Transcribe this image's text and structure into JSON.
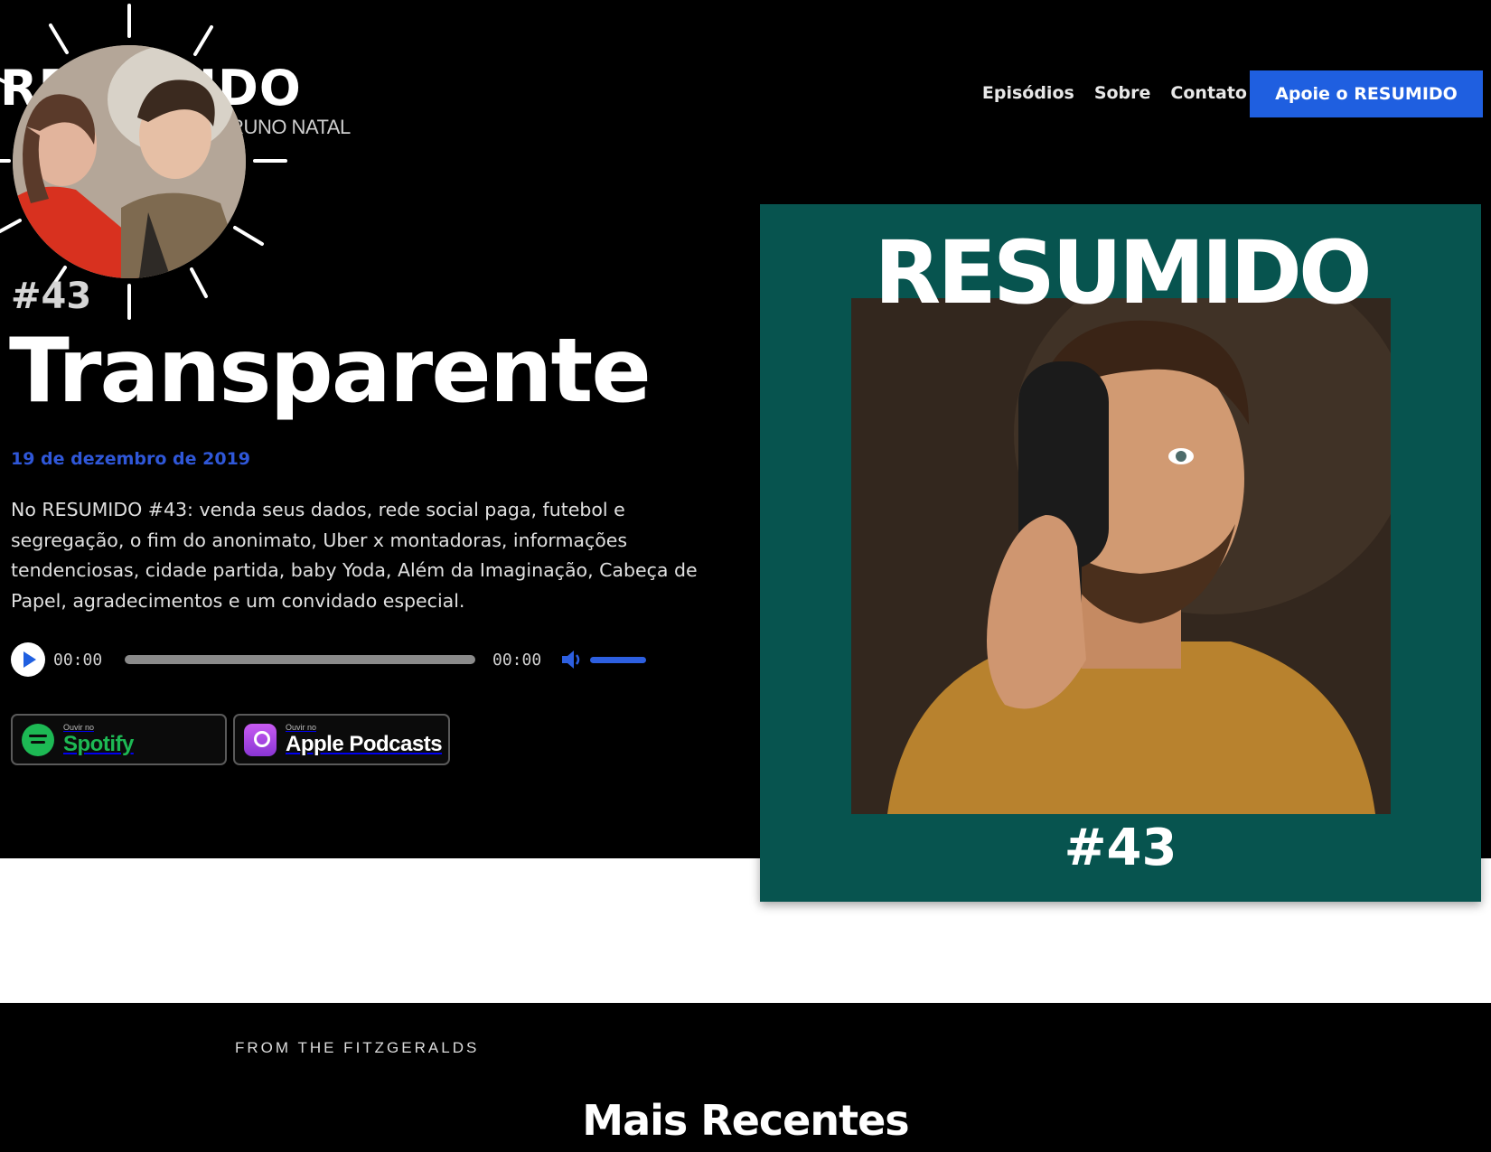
{
  "header": {
    "logo_wordmark": "RESUMIDO",
    "logo_subtitle": "BRUNO NATAL",
    "nav": [
      {
        "label": "Episódios"
      },
      {
        "label": "Sobre"
      },
      {
        "label": "Contato"
      }
    ],
    "cta_label": "Apoie o RESUMIDO"
  },
  "episode": {
    "number": "#43",
    "title": "Transparente",
    "date": "19 de dezembro de 2019",
    "description": "No RESUMIDO #43: venda seus dados, rede social paga, futebol e segregação, o fim do anonimato, Uber x montadoras, informações tendenciosas, cidade partida, baby Yoda, Além da Imaginação, Cabeça de Papel, agradecimentos e um convidado especial."
  },
  "player": {
    "current_time": "00:00",
    "total_time": "00:00",
    "progress": 0
  },
  "badges": {
    "spotify_small": "Ouvir no",
    "spotify_big": "Spotify",
    "apple_small": "Ouvir no",
    "apple_big": "Apple Podcasts"
  },
  "cover": {
    "title": "RESUMIDO",
    "number": "#43"
  },
  "footer": {
    "from_label": "FROM THE FITZGERALDS",
    "section_title": "Mais Recentes"
  },
  "colors": {
    "accent": "#1f5fe0",
    "cover_bg": "#07544f",
    "date": "#2f57d8",
    "spotify": "#1db954"
  }
}
